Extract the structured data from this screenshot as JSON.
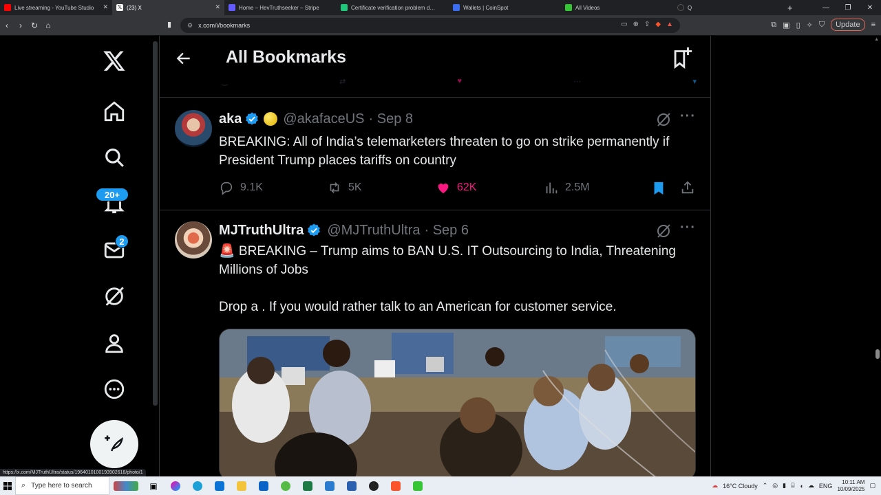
{
  "browser": {
    "tabs": [
      {
        "title": "Live streaming - YouTube Studio",
        "color": "#ff0000",
        "active": false
      },
      {
        "title": "(23) X",
        "color": "#ffffff",
        "active": true
      },
      {
        "title": "Home – HevTruthseeker – Stripe",
        "color": "#635bff",
        "active": false
      },
      {
        "title": "Certificate verification problem dete",
        "color": "#1ec77a",
        "active": false
      },
      {
        "title": "Wallets | CoinSpot",
        "color": "#3a6df0",
        "active": false
      },
      {
        "title": "All Videos",
        "color": "#35c535",
        "active": false
      },
      {
        "title": "Q",
        "color": "#222222",
        "active": false
      }
    ],
    "url": "x.com/i/bookmarks",
    "update_label": "Update",
    "status_link": "https://x.com/MJTruthUltra/status/1964010100193902618/photo/1"
  },
  "nav": {
    "notifications_badge": "20+",
    "messages_badge": "2"
  },
  "header": {
    "title": "All Bookmarks"
  },
  "posts": [
    {
      "name": "aka",
      "handle": "@akafaceUS",
      "date": "· Sep 8",
      "text": "BREAKING: All of India’s telemarketers threaten to go on strike permanently if President Trump places tariffs on country",
      "replies": "9.1K",
      "reposts": "5K",
      "likes": "62K",
      "views": "2.5M"
    },
    {
      "name": "MJTruthUltra",
      "handle": "@MJTruthUltra",
      "date": "· Sep 6",
      "text": "🚨 BREAKING – Trump aims to BAN U.S. IT Outsourcing to India, Threatening Millions of Jobs\n\nDrop a . If you would rather talk to an American for customer service."
    }
  ],
  "taskbar": {
    "search_placeholder": "Type here to search",
    "weather": "16°C  Cloudy",
    "lang": "ENG",
    "time": "10:11 AM",
    "date": "10/09/2025"
  }
}
